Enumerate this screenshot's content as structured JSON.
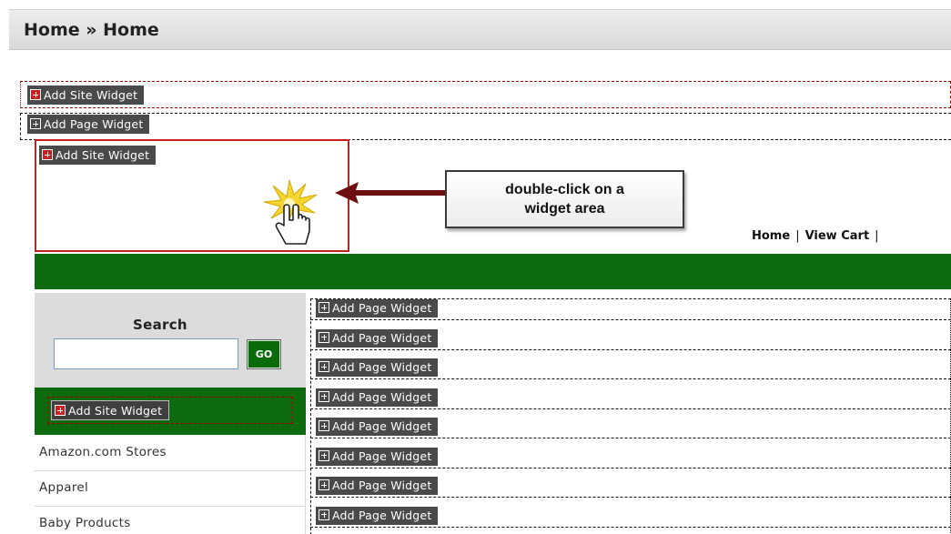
{
  "breadcrumb": "Home » Home",
  "widgets": {
    "add_site_label": "Add Site Widget",
    "add_page_label": "Add Page Widget"
  },
  "callout": {
    "line1": "double-click on a",
    "line2": "widget area"
  },
  "top_nav": {
    "items": [
      "Home",
      "View Cart"
    ],
    "separator": "|"
  },
  "search": {
    "title": "Search",
    "input_value": "",
    "go_label": "GO"
  },
  "categories": [
    "Amazon.com Stores",
    "Apparel",
    "Baby Products"
  ],
  "colors": {
    "header_green": "#0e6a0e",
    "site_widget_plus": "#cc1f1f",
    "widget_button": "#4a4a4a",
    "highlight_border": "#c42020"
  }
}
